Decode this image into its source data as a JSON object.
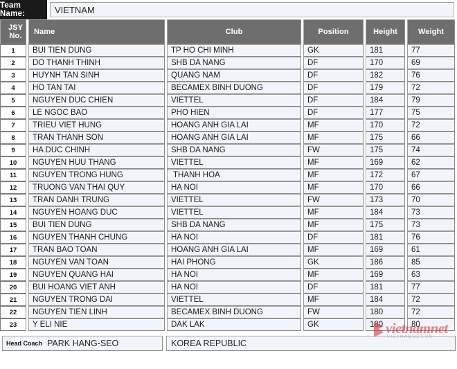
{
  "team_name": {
    "label": "Team Name:",
    "value": "VIETNAM"
  },
  "columns": {
    "jsy": "JSY No.",
    "name": "Name",
    "club": "Club",
    "position": "Position",
    "height": "Height",
    "weight": "Weight"
  },
  "rows": [
    {
      "jsy": "1",
      "name": "BUI TIEN DUNG",
      "club": "TP HO CHI MINH",
      "position": "GK",
      "height": "181",
      "weight": "77"
    },
    {
      "jsy": "2",
      "name": "DO THANH THINH",
      "club": "SHB DA NANG",
      "position": "DF",
      "height": "170",
      "weight": "69"
    },
    {
      "jsy": "3",
      "name": "HUYNH TAN SINH",
      "club": "QUANG NAM",
      "position": "DF",
      "height": "182",
      "weight": "76"
    },
    {
      "jsy": "4",
      "name": "HO TAN TAI",
      "club": "BECAMEX BINH DUONG",
      "position": "DF",
      "height": "179",
      "weight": "72"
    },
    {
      "jsy": "5",
      "name": "NGUYEN DUC CHIEN",
      "club": "VIETTEL",
      "position": "DF",
      "height": "184",
      "weight": "79"
    },
    {
      "jsy": "6",
      "name": "LE NGOC BAO",
      "club": "PHO HIEN",
      "position": "DF",
      "height": "177",
      "weight": "75"
    },
    {
      "jsy": "7",
      "name": "TRIEU VIET HUNG",
      "club": "HOANG ANH GIA LAI",
      "position": "MF",
      "height": "170",
      "weight": "72"
    },
    {
      "jsy": "8",
      "name": "TRAN THANH SON",
      "club": "HOANG ANH GIA LAI",
      "position": "MF",
      "height": "175",
      "weight": "66"
    },
    {
      "jsy": "9",
      "name": "HA DUC CHINH",
      "club": "SHB DA NANG",
      "position": "FW",
      "height": "175",
      "weight": "74"
    },
    {
      "jsy": "10",
      "name": "NGUYEN HUU THANG",
      "club": "VIETTEL",
      "position": "MF",
      "height": "169",
      "weight": "62"
    },
    {
      "jsy": "11",
      "name": "NGUYEN TRONG HUNG",
      "club": " THANH HOA",
      "position": "MF",
      "height": "172",
      "weight": "67"
    },
    {
      "jsy": "12",
      "name": "TRUONG VAN THAI QUY",
      "club": "HA NOI",
      "position": "MF",
      "height": "170",
      "weight": "66"
    },
    {
      "jsy": "13",
      "name": "TRAN DANH TRUNG",
      "club": "VIETTEL",
      "position": "FW",
      "height": "173",
      "weight": "70"
    },
    {
      "jsy": "14",
      "name": "NGUYEN HOANG DUC",
      "club": "VIETTEL",
      "position": "MF",
      "height": "184",
      "weight": "73"
    },
    {
      "jsy": "15",
      "name": "BUI TIEN DUNG",
      "club": "SHB DA NANG",
      "position": "MF",
      "height": "175",
      "weight": "73"
    },
    {
      "jsy": "16",
      "name": "NGUYEN THANH CHUNG",
      "club": "HA NOI",
      "position": "DF",
      "height": "181",
      "weight": "76"
    },
    {
      "jsy": "17",
      "name": "TRAN BAO TOAN",
      "club": "HOANG ANH GIA LAI",
      "position": "MF",
      "height": "169",
      "weight": "61"
    },
    {
      "jsy": "18",
      "name": "NGUYEN VAN TOAN",
      "club": "HAI PHONG",
      "position": "GK",
      "height": "186",
      "weight": "85"
    },
    {
      "jsy": "19",
      "name": "NGUYEN QUANG HAI",
      "club": "HA NOI",
      "position": "MF",
      "height": "169",
      "weight": "63"
    },
    {
      "jsy": "20",
      "name": "BUI HOANG VIET ANH",
      "club": "HA NOI",
      "position": "DF",
      "height": "181",
      "weight": "77"
    },
    {
      "jsy": "21",
      "name": "NGUYEN TRONG DAI",
      "club": "VIETTEL",
      "position": "MF",
      "height": "184",
      "weight": "72"
    },
    {
      "jsy": "22",
      "name": "NGUYEN TIEN LINH",
      "club": "BECAMEX BINH DUONG",
      "position": "FW",
      "height": "180",
      "weight": "72"
    },
    {
      "jsy": "23",
      "name": "Y ELI NIE",
      "club": "DAK LAK",
      "position": "GK",
      "height": "180",
      "weight": "80"
    }
  ],
  "footer": {
    "coach_label": "Head Coach",
    "coach_name": "PARK HANG-SEO",
    "coach_country": "KOREA REPUBLIC"
  },
  "watermark": {
    "text": "vietnamnet",
    "subtext": "VIETNAMNET.VN"
  },
  "colors": {
    "header_bg": "#6e6e6e",
    "label_bg": "#1a1a1a",
    "cell_bg": "#f2f4fb",
    "watermark_red": "#d63a3f"
  }
}
